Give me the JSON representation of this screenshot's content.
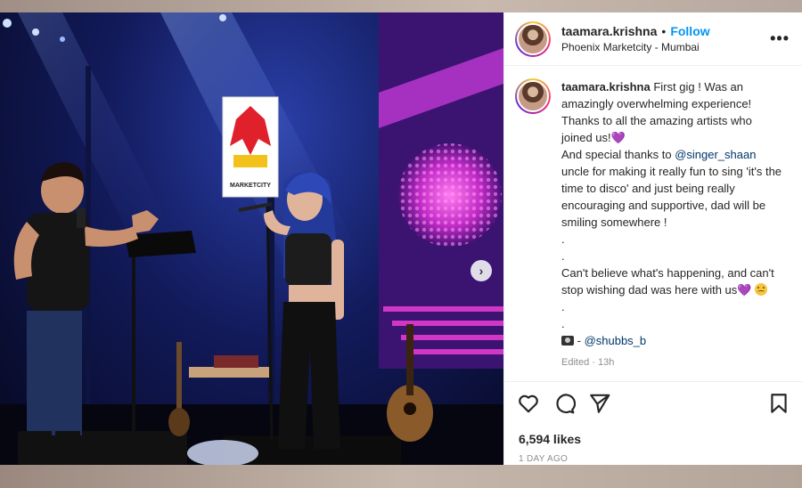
{
  "post": {
    "username": "taamara.krishna",
    "follow_label": "Follow",
    "dot": "•",
    "location": "Phoenix Marketcity - Mumbai",
    "more_label": "•••",
    "caption_user": "taamara.krishna",
    "caption_line1": "First gig ! Was an amazingly overwhelming experience! Thanks to all the amazing artists who joined us!",
    "caption_line2_pre": "And special thanks to ",
    "caption_mention1": "@singer_shaan",
    "caption_line2_post": " uncle for making it really fun to sing 'it's the time to disco' and just being really encouraging and supportive, dad will be smiling somewhere !",
    "dot_line": ".",
    "caption_line3": "Can't believe what's happening, and can't stop wishing dad was here with us",
    "credit_sep": " - ",
    "caption_mention2": "@shubbs_b",
    "edited": "Edited · 13h",
    "likes": "6,594 likes",
    "ago": "1 DAY AGO",
    "heart_emoji": "💜",
    "next_arrow": "›"
  },
  "photo_sign": {
    "brand": "MARKETCITY"
  },
  "colors": {
    "follow": "#0095f6",
    "mention": "#00376b",
    "stage_blue": "#1b2a8c",
    "disco_pink": "#e23ad0"
  },
  "icons": [
    "heart-icon",
    "comment-icon",
    "share-icon",
    "bookmark-icon",
    "more-icon",
    "chevron-right-icon",
    "camera-icon"
  ]
}
